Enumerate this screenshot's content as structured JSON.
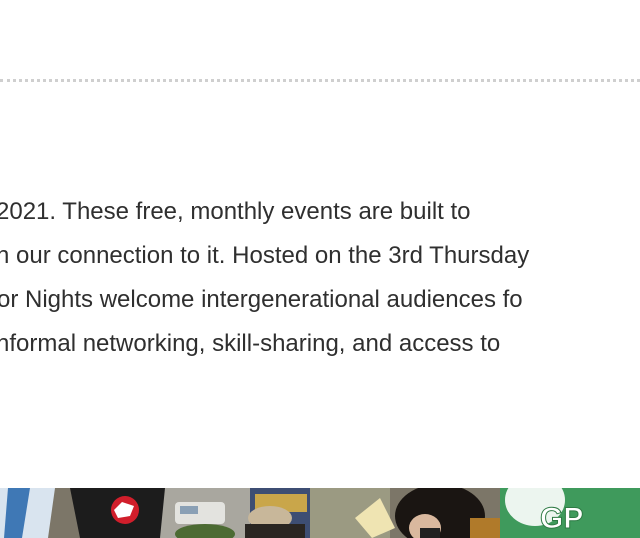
{
  "article": {
    "paragraph_lines": [
      "2021. These free, monthly events are built to",
      "n our connection to it. Hosted on the 3rd Thursday",
      "or Nights welcome intergenerational audiences fo",
      "nformal networking, skill-sharing, and access to"
    ]
  },
  "photo": {
    "sign_texts": [
      "GP"
    ]
  },
  "colors": {
    "text": "#2f2f2f",
    "divider": "#cfcfcf",
    "background": "#ffffff"
  }
}
